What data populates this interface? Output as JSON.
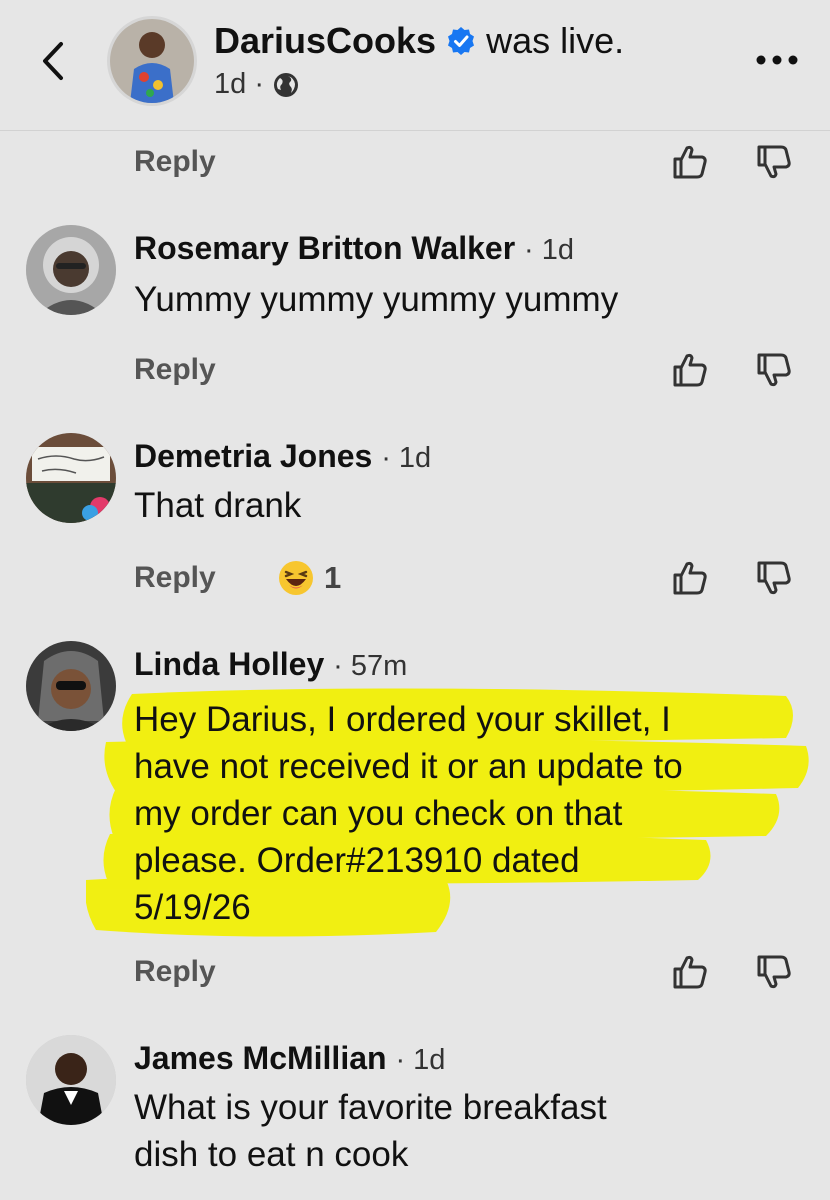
{
  "header": {
    "name": "DariusCooks",
    "suffix": "was live.",
    "time": "1d ·"
  },
  "replies": {
    "label": "Reply"
  },
  "comments": [
    {
      "name": "Rosemary Britton Walker",
      "time": "· 1d",
      "text": "Yummy yummy yummy yummy"
    },
    {
      "name": "Demetria Jones",
      "time": "· 1d",
      "text": "That drank",
      "reaction_count": "1"
    },
    {
      "name": "Linda Holley",
      "time": "· 57m",
      "text_lines": [
        "Hey Darius, I ordered your skillet, I",
        "have not received it or an update to",
        "my order can you check on that",
        "please. Order#213910 dated",
        "5/19/26"
      ]
    },
    {
      "name": "James McMillian",
      "time": "· 1d",
      "text_lines": [
        "What is your favorite breakfast",
        "dish to eat n cook"
      ]
    }
  ],
  "colors": {
    "highlight": "#f2f000",
    "verified": "#1877f2"
  },
  "icons": [
    "back-icon",
    "verified-icon",
    "globe-icon",
    "more-icon",
    "thumbs-up-icon",
    "thumbs-down-icon",
    "laughing-emoji-icon"
  ]
}
